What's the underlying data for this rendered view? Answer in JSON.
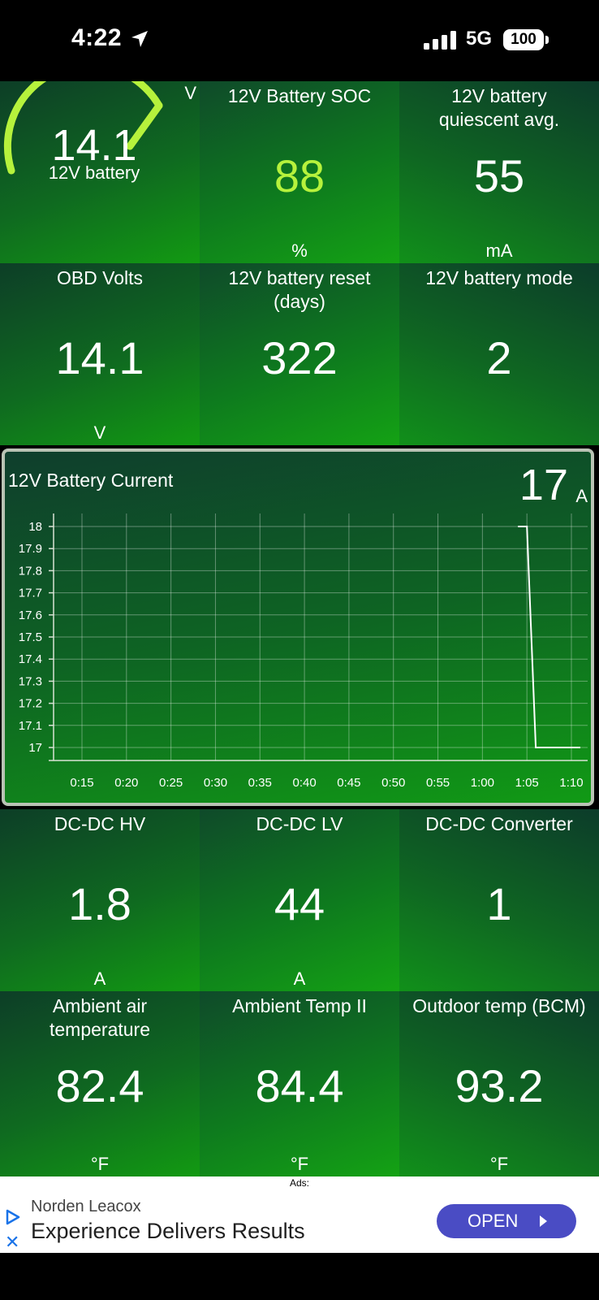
{
  "status_bar": {
    "time": "4:22",
    "network": "5G",
    "battery": "100"
  },
  "tiles": [
    {
      "label": "12V Battery SOC",
      "value": "88",
      "unit": "%",
      "value_color": "#b6f23c"
    },
    {
      "label": "12V battery quiescent avg.",
      "value": "55",
      "unit": "mA"
    },
    {
      "label": "OBD Volts",
      "value": "14.1",
      "unit": "V"
    },
    {
      "label": "12V battery reset (days)",
      "value": "322",
      "unit": ""
    },
    {
      "label": "12V battery mode",
      "value": "2",
      "unit": ""
    },
    {
      "label": "DC-DC HV",
      "value": "1.8",
      "unit": "A"
    },
    {
      "label": "DC-DC LV",
      "value": "44",
      "unit": "A"
    },
    {
      "label": "DC-DC Converter",
      "value": "1",
      "unit": ""
    },
    {
      "label": "Ambient air temperature",
      "value": "82.4",
      "unit": "°F"
    },
    {
      "label": "Ambient Temp II",
      "value": "84.4",
      "unit": "°F"
    },
    {
      "label": "Outdoor temp (BCM)",
      "value": "93.2",
      "unit": "°F"
    }
  ],
  "gauge": {
    "label": "12V battery",
    "value": "14.1",
    "unit": "V",
    "color": "#b6f23c"
  },
  "chart_panel": {
    "title": "12V Battery Current",
    "current_value": "17",
    "unit": "A"
  },
  "chart_data": {
    "type": "line",
    "title": "12V Battery Current",
    "y_ticks": [
      "18",
      "17.9",
      "17.8",
      "17.7",
      "17.6",
      "17.5",
      "17.4",
      "17.3",
      "17.2",
      "17.1",
      "17"
    ],
    "x_ticks": [
      "0:15",
      "0:20",
      "0:25",
      "0:30",
      "0:35",
      "0:40",
      "0:45",
      "0:50",
      "0:55",
      "1:00",
      "1:05",
      "1:10"
    ],
    "ylim": [
      17,
      18
    ],
    "grid": true,
    "series": [
      {
        "x": [
          "1:04",
          "1:05",
          "1:06",
          "1:11"
        ],
        "values": [
          18,
          18,
          17,
          17
        ]
      }
    ]
  },
  "ad": {
    "label": "Ads:",
    "sponsor": "Norden Leacox",
    "headline": "Experience Delivers Results",
    "button": "OPEN"
  }
}
